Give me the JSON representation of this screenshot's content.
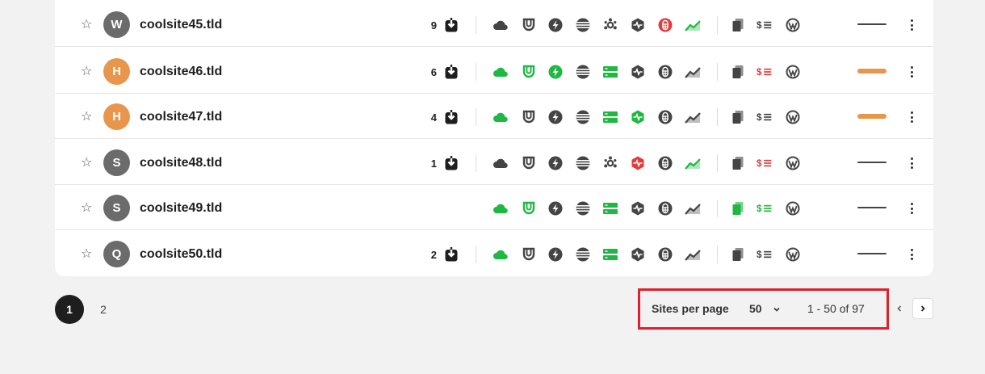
{
  "colors": {
    "green": "#1fb843",
    "red": "#e23b3b",
    "gray": "#444444",
    "orange": "#e8964c",
    "avatar_gray": "#6b6b6b",
    "avatar_orange": "#e8964c"
  },
  "sites": [
    {
      "initial": "W",
      "name": "coolsite45.tld",
      "avatar_color": "#6b6b6b",
      "updates": "9",
      "services": {
        "backup": "gray",
        "security": "gray",
        "performance": "gray",
        "uptime": "gray",
        "analytics": "gray",
        "monitor": "gray",
        "vulnerability": "red",
        "seo": "green",
        "reports": "gray",
        "client": "gray",
        "wordpress": "gray"
      },
      "health": "neutral"
    },
    {
      "initial": "H",
      "name": "coolsite46.tld",
      "avatar_color": "#e8964c",
      "updates": "6",
      "services": {
        "backup": "green",
        "security": "green",
        "performance": "green",
        "uptime": "gray",
        "analytics": "green",
        "monitor": "gray",
        "vulnerability": "gray",
        "seo": "gray",
        "reports": "gray",
        "client": "red",
        "wordpress": "gray"
      },
      "health": "warn"
    },
    {
      "initial": "H",
      "name": "coolsite47.tld",
      "avatar_color": "#e8964c",
      "updates": "4",
      "services": {
        "backup": "green",
        "security": "gray",
        "performance": "gray",
        "uptime": "gray",
        "analytics": "green",
        "monitor": "green",
        "vulnerability": "gray",
        "seo": "gray",
        "reports": "gray",
        "client": "gray",
        "wordpress": "gray"
      },
      "health": "warn"
    },
    {
      "initial": "S",
      "name": "coolsite48.tld",
      "avatar_color": "#6b6b6b",
      "updates": "1",
      "services": {
        "backup": "gray",
        "security": "gray",
        "performance": "gray",
        "uptime": "gray",
        "analytics": "gray",
        "monitor": "red",
        "vulnerability": "gray",
        "seo": "green",
        "reports": "gray",
        "client": "red",
        "wordpress": "gray"
      },
      "health": "neutral"
    },
    {
      "initial": "S",
      "name": "coolsite49.tld",
      "avatar_color": "#6b6b6b",
      "updates": "",
      "services": {
        "backup": "green",
        "security": "green",
        "performance": "gray",
        "uptime": "gray",
        "analytics": "green",
        "monitor": "gray",
        "vulnerability": "gray",
        "seo": "gray",
        "reports": "green",
        "client": "green",
        "wordpress": "gray"
      },
      "health": "neutral"
    },
    {
      "initial": "Q",
      "name": "coolsite50.tld",
      "avatar_color": "#6b6b6b",
      "updates": "2",
      "services": {
        "backup": "green",
        "security": "gray",
        "performance": "gray",
        "uptime": "gray",
        "analytics": "green",
        "monitor": "gray",
        "vulnerability": "gray",
        "seo": "gray",
        "reports": "gray",
        "client": "gray",
        "wordpress": "gray"
      },
      "health": "neutral"
    }
  ],
  "pagination": {
    "pages": [
      "1",
      "2"
    ],
    "current": "1",
    "per_page_label": "Sites per page",
    "per_page_value": "50",
    "range_text": "1 - 50 of 97"
  }
}
